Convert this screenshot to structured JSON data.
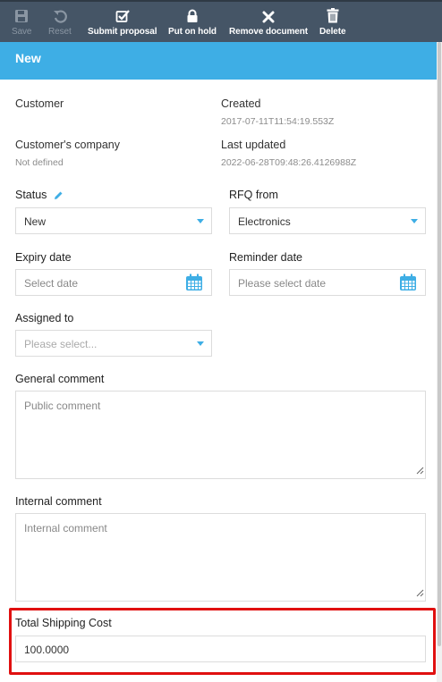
{
  "toolbar": {
    "save": "Save",
    "reset": "Reset",
    "submit": "Submit proposal",
    "hold": "Put on hold",
    "remove": "Remove document",
    "delete": "Delete"
  },
  "header": {
    "title": "New"
  },
  "info": {
    "customer_label": "Customer",
    "created_label": "Created",
    "created_value": "2017-07-11T11:54:19.553Z",
    "company_label": "Customer's company",
    "company_value": "Not defined",
    "updated_label": "Last updated",
    "updated_value": "2022-06-28T09:48:26.4126988Z"
  },
  "form": {
    "status_label": "Status",
    "status_value": "New",
    "rfq_label": "RFQ from",
    "rfq_value": "Electronics",
    "expiry_label": "Expiry date",
    "expiry_placeholder": "Select date",
    "reminder_label": "Reminder date",
    "reminder_placeholder": "Please select date",
    "assigned_label": "Assigned to",
    "assigned_placeholder": "Please select...",
    "general_label": "General comment",
    "general_placeholder": "Public comment",
    "internal_label": "Internal comment",
    "internal_placeholder": "Internal comment",
    "shipping_label": "Total Shipping Cost",
    "shipping_value": "100.0000"
  },
  "icons": {
    "save": "floppy-disk-icon",
    "reset": "undo-icon",
    "submit": "checkbox-icon",
    "hold": "lock-icon",
    "remove": "x-icon",
    "delete": "trash-icon",
    "status_edit": "pencil-icon",
    "calendar": "calendar-icon",
    "dropdown": "caret-down-icon"
  },
  "colors": {
    "toolbar_bg": "#455566",
    "header_bg": "#3eaee5",
    "accent": "#3eaee5",
    "highlight": "#e01010"
  }
}
